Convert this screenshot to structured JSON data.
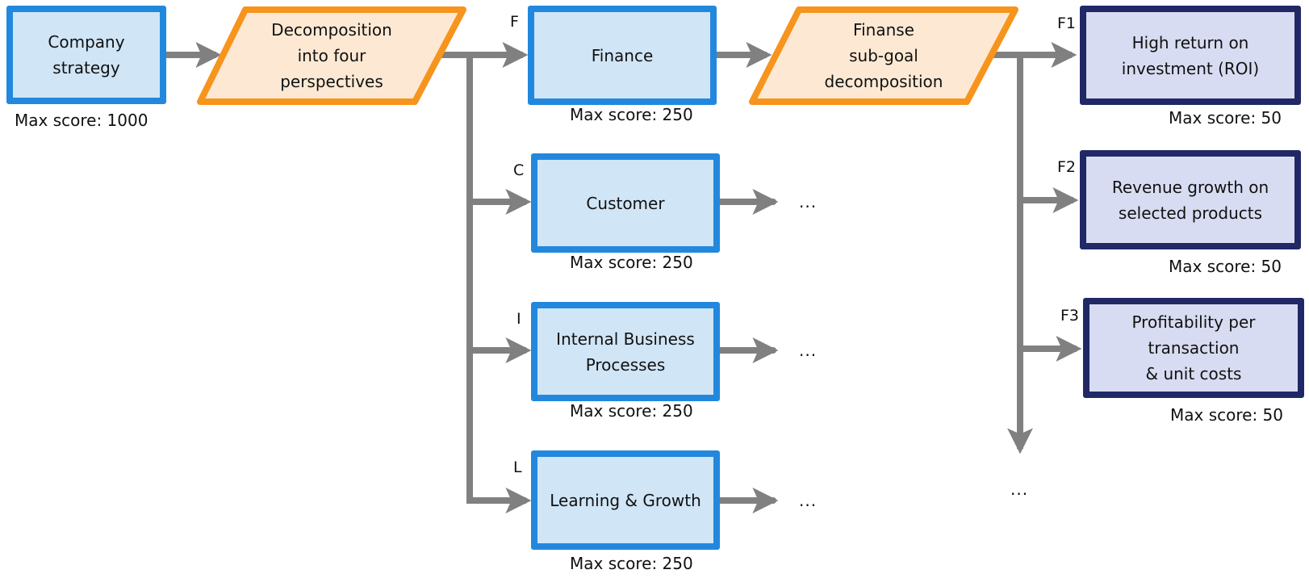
{
  "colors": {
    "perspective_border": "#2288dd",
    "perspective_fill": "#d0e5f6",
    "decomposition_border": "#f7941d",
    "decomposition_fill": "#fde9d3",
    "subgoal_border": "#212866",
    "subgoal_fill": "#d8dcf2",
    "connector": "#808080"
  },
  "nodes": {
    "company_strategy": {
      "text": "Company\nstrategy",
      "score": "Max score: 1000"
    },
    "decomposition": {
      "text": "Decomposition\ninto four\nperspectives"
    },
    "finance": {
      "tag": "F",
      "text": "Finance",
      "score": "Max score: 250"
    },
    "customer": {
      "tag": "C",
      "text": "Customer",
      "score": "Max score: 250"
    },
    "internal": {
      "tag": "I",
      "text": "Internal Business\nProcesses",
      "score": "Max score: 250"
    },
    "learning": {
      "tag": "L",
      "text": "Learning & Growth",
      "score": "Max score: 250"
    },
    "finance_decomposition": {
      "text": "Finanse\nsub-goal\ndecomposition"
    },
    "f1": {
      "tag": "F1",
      "text": "High return on\ninvestment (ROI)",
      "score": "Max score: 50"
    },
    "f2": {
      "tag": "F2",
      "text": "Revenue growth on\nselected products",
      "score": "Max score: 50"
    },
    "f3": {
      "tag": "F3",
      "text": "Profitability per\ntransaction\n& unit costs",
      "score": "Max score: 50"
    }
  },
  "continuation": {
    "customer": "...",
    "internal": "...",
    "learning": "...",
    "finance_more": "..."
  }
}
